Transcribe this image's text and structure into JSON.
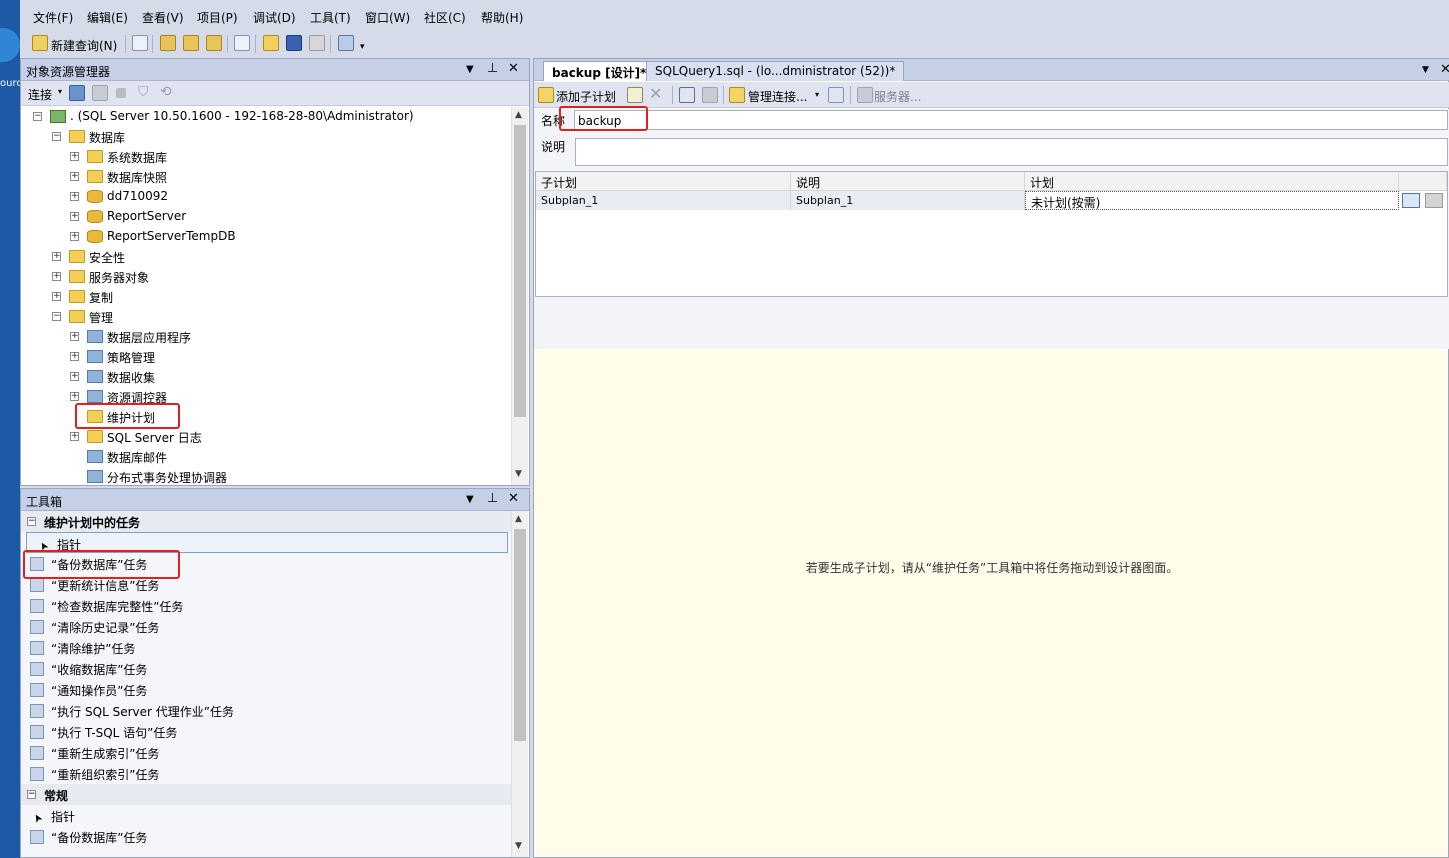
{
  "menu": [
    "文件(F)",
    "编辑(E)",
    "查看(V)",
    "项目(P)",
    "调试(D)",
    "工具(T)",
    "窗口(W)",
    "社区(C)",
    "帮助(H)"
  ],
  "desktop_text": "ourc",
  "toolbar": {
    "new_query": "新建查询(N)"
  },
  "object_explorer": {
    "title": "对象资源管理器",
    "connect": "连接",
    "tree": [
      {
        "label": ". (SQL Server 10.50.1600 - 192-168-28-80\\Administrator)",
        "level": 0,
        "expander": "−",
        "icon": "server"
      },
      {
        "label": "数据库",
        "level": 1,
        "expander": "−",
        "icon": "folder"
      },
      {
        "label": "系统数据库",
        "level": 2,
        "expander": "+",
        "icon": "folder"
      },
      {
        "label": "数据库快照",
        "level": 2,
        "expander": "+",
        "icon": "folder"
      },
      {
        "label": "dd710092",
        "level": 2,
        "expander": "+",
        "icon": "database"
      },
      {
        "label": "ReportServer",
        "level": 2,
        "expander": "+",
        "icon": "database"
      },
      {
        "label": "ReportServerTempDB",
        "level": 2,
        "expander": "+",
        "icon": "database"
      },
      {
        "label": "安全性",
        "level": 1,
        "expander": "+",
        "icon": "folder"
      },
      {
        "label": "服务器对象",
        "level": 1,
        "expander": "+",
        "icon": "folder"
      },
      {
        "label": "复制",
        "level": 1,
        "expander": "+",
        "icon": "folder"
      },
      {
        "label": "管理",
        "level": 1,
        "expander": "−",
        "icon": "folder"
      },
      {
        "label": "数据层应用程序",
        "level": 2,
        "expander": "+",
        "icon": "gear"
      },
      {
        "label": "策略管理",
        "level": 2,
        "expander": "+",
        "icon": "gear"
      },
      {
        "label": "数据收集",
        "level": 2,
        "expander": "+",
        "icon": "gear"
      },
      {
        "label": "资源调控器",
        "level": 2,
        "expander": "+",
        "icon": "gear"
      },
      {
        "label": "维护计划",
        "level": 2,
        "expander": "",
        "icon": "folder"
      },
      {
        "label": "SQL Server 日志",
        "level": 2,
        "expander": "+",
        "icon": "folder"
      },
      {
        "label": "数据库邮件",
        "level": 2,
        "expander": "",
        "icon": "gear"
      },
      {
        "label": "分布式事务处理协调器",
        "level": 2,
        "expander": "",
        "icon": "gear"
      }
    ]
  },
  "toolbox": {
    "title": "工具箱",
    "groups": [
      {
        "name": "维护计划中的任务",
        "items": [
          "指针",
          "“备份数据库”任务",
          "“更新统计信息”任务",
          "“检查数据库完整性”任务",
          "“清除历史记录”任务",
          "“清除维护”任务",
          "“收缩数据库”任务",
          "“通知操作员”任务",
          "“执行 SQL Server 代理作业”任务",
          "“执行 T-SQL 语句”任务",
          "“重新生成索引”任务",
          "“重新组织索引”任务"
        ]
      },
      {
        "name": "常规",
        "items": [
          "指针",
          "“备份数据库”任务"
        ]
      }
    ]
  },
  "tabs": [
    {
      "label": "backup [设计]*",
      "active": true
    },
    {
      "label": "SQLQuery1.sql - (lo...dministrator (52))*",
      "active": false
    }
  ],
  "designer_toolbar": {
    "add_subplan": "添加子计划",
    "manage_connections": "管理连接...",
    "servers": "服务器..."
  },
  "form": {
    "name_label": "名称",
    "name_value": "backup",
    "desc_label": "说明",
    "desc_value": ""
  },
  "subplan_grid": {
    "columns": [
      "子计划",
      "说明",
      "计划"
    ],
    "rows": [
      [
        "Subplan_1",
        "Subplan_1",
        "未计划(按需)"
      ]
    ]
  },
  "hint": "若要生成子计划，请从“维护任务”工具箱中将任务拖动到设计器图面。"
}
